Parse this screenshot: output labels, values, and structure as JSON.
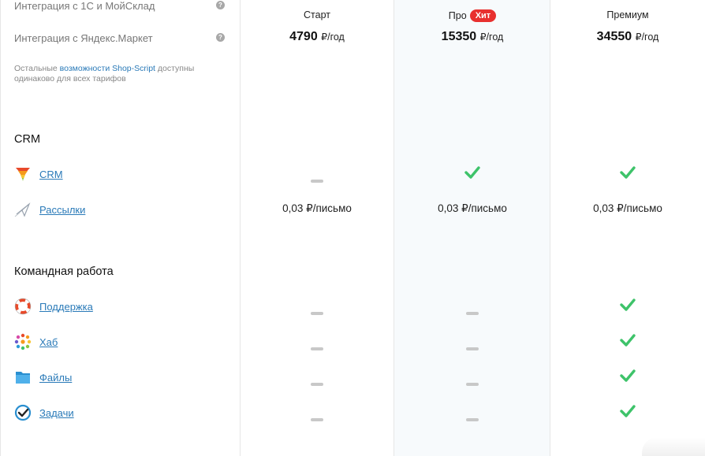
{
  "features": [
    {
      "label": "Интеграция с 1С и МойСклад",
      "help": "?"
    },
    {
      "label": "Интеграция с Яндекс.Маркет",
      "help": "?"
    }
  ],
  "note": {
    "prefix": "Остальные ",
    "link": "возможности Shop-Script",
    "suffix": " доступны одинаково для всех тарифов"
  },
  "plans": [
    {
      "name": "Старт",
      "price": "4790",
      "period": "₽/год"
    },
    {
      "name": "Про",
      "badge": "Хит",
      "price": "15350",
      "period": "₽/год"
    },
    {
      "name": "Премиум",
      "price": "34550",
      "period": "₽/год"
    }
  ],
  "sections": {
    "crm": {
      "title": "CRM",
      "apps": [
        {
          "label": "CRM",
          "icon": "crm-funnel-icon",
          "values": [
            "dash",
            "check",
            "check"
          ]
        },
        {
          "label": "Рассылки",
          "icon": "mailer-icon",
          "values": [
            "0,03 ₽/письмо",
            "0,03 ₽/письмо",
            "0,03 ₽/письмо"
          ]
        }
      ]
    },
    "team": {
      "title": "Командная работа",
      "apps": [
        {
          "label": "Поддержка",
          "icon": "lifebuoy-icon",
          "values": [
            "dash",
            "dash",
            "check"
          ]
        },
        {
          "label": "Хаб",
          "icon": "hub-icon",
          "values": [
            "dash",
            "dash",
            "check"
          ]
        },
        {
          "label": "Файлы",
          "icon": "folder-icon",
          "values": [
            "dash",
            "dash",
            "check"
          ]
        },
        {
          "label": "Задачи",
          "icon": "tasks-icon",
          "values": [
            "dash",
            "dash",
            "check"
          ]
        }
      ]
    }
  },
  "colors": {
    "link": "#2a7ab8",
    "check": "#3ec36a",
    "badge": "#e8302f",
    "dash": "#c8c8c8"
  }
}
